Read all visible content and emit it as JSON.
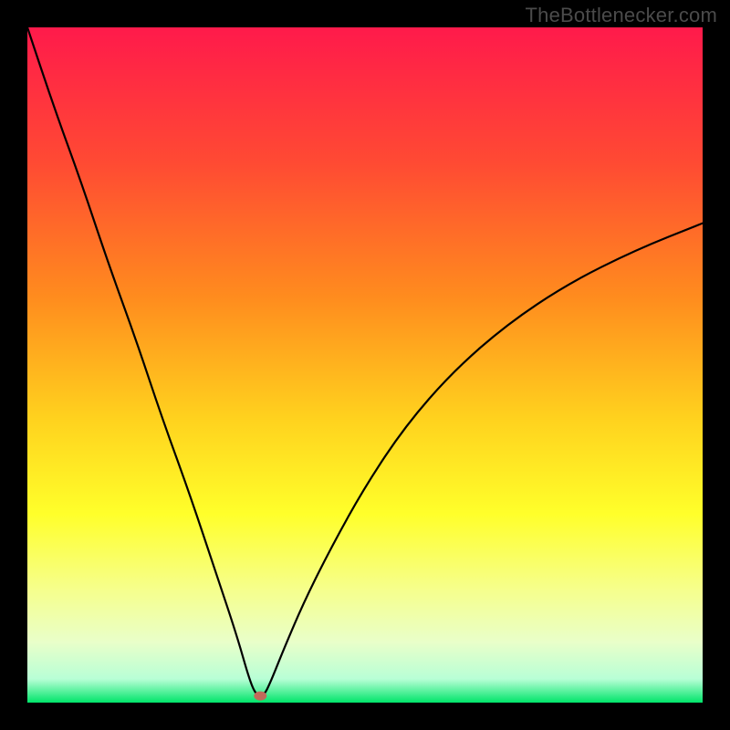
{
  "watermark": {
    "text": "TheBottlenecker.com"
  },
  "colors": {
    "frame": "#000000",
    "watermark": "#4b4b4b",
    "curve": "#000000",
    "marker": "#c26a5a",
    "gradient_stops": [
      {
        "offset": 0.0,
        "color": "#ff1a4b"
      },
      {
        "offset": 0.2,
        "color": "#ff4a33"
      },
      {
        "offset": 0.4,
        "color": "#ff8c1e"
      },
      {
        "offset": 0.58,
        "color": "#ffd21e"
      },
      {
        "offset": 0.72,
        "color": "#ffff2a"
      },
      {
        "offset": 0.83,
        "color": "#f6ff8a"
      },
      {
        "offset": 0.91,
        "color": "#e9ffc9"
      },
      {
        "offset": 0.965,
        "color": "#b8ffd6"
      },
      {
        "offset": 1.0,
        "color": "#00e56a"
      }
    ]
  },
  "chart_data": {
    "type": "line",
    "title": "",
    "xlabel": "",
    "ylabel": "",
    "xlim": [
      0,
      100
    ],
    "ylim": [
      0,
      100
    ],
    "description": "V-shaped bottleneck curve: steep linear descent from top-left to a minimum near x≈34, then a concave rise toward the right. Vertical gradient background encodes severity (red=high at top, green=low at bottom).",
    "series": [
      {
        "name": "bottleneck-curve",
        "x": [
          0,
          4,
          8,
          12,
          16,
          20,
          24,
          28,
          31,
          33,
          34,
          35,
          36,
          38,
          41,
          45,
          50,
          56,
          63,
          71,
          80,
          90,
          100
        ],
        "y": [
          100,
          88,
          77,
          65,
          54,
          42,
          31,
          19,
          10,
          3,
          1,
          1,
          3,
          8,
          15,
          23,
          32,
          41,
          49,
          56,
          62,
          67,
          71
        ]
      }
    ],
    "marker": {
      "x": 34.5,
      "y": 1.0
    }
  }
}
